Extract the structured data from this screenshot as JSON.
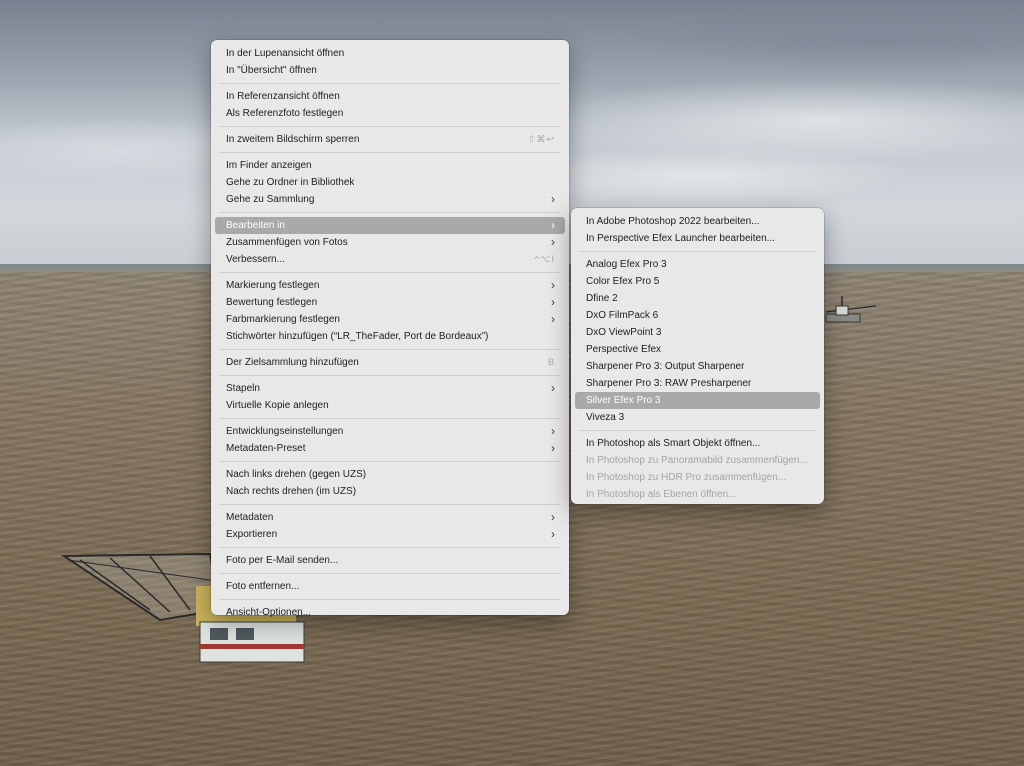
{
  "main_menu": {
    "groups": [
      [
        {
          "label": "In der Lupenansicht öffnen"
        },
        {
          "label": "In \"Übersicht\" öffnen"
        }
      ],
      [
        {
          "label": "In Referenzansicht öffnen"
        },
        {
          "label": "Als Referenzfoto festlegen"
        }
      ],
      [
        {
          "label": "In zweitem Bildschirm sperren",
          "shortcut": "⇧⌘↩"
        }
      ],
      [
        {
          "label": "Im Finder anzeigen"
        },
        {
          "label": "Gehe zu Ordner in Bibliothek"
        },
        {
          "label": "Gehe zu Sammlung",
          "submenu": true
        }
      ],
      [
        {
          "label": "Bearbeiten in",
          "submenu": true,
          "highlighted": true
        },
        {
          "label": "Zusammenfügen von Fotos",
          "submenu": true
        },
        {
          "label": "Verbessern...",
          "shortcut": "^⌥I"
        }
      ],
      [
        {
          "label": "Markierung festlegen",
          "submenu": true
        },
        {
          "label": "Bewertung festlegen",
          "submenu": true
        },
        {
          "label": "Farbmarkierung festlegen",
          "submenu": true
        },
        {
          "label": "Stichwörter hinzufügen (“LR_TheFader, Port de Bordeaux”)"
        }
      ],
      [
        {
          "label": "Der Zielsammlung hinzufügen",
          "shortcut": "B"
        }
      ],
      [
        {
          "label": "Stapeln",
          "submenu": true
        },
        {
          "label": "Virtuelle Kopie anlegen"
        }
      ],
      [
        {
          "label": "Entwicklungseinstellungen",
          "submenu": true
        },
        {
          "label": "Metadaten-Preset",
          "submenu": true
        }
      ],
      [
        {
          "label": "Nach links drehen (gegen UZS)"
        },
        {
          "label": "Nach rechts drehen (im UZS)"
        }
      ],
      [
        {
          "label": "Metadaten",
          "submenu": true
        },
        {
          "label": "Exportieren",
          "submenu": true
        }
      ],
      [
        {
          "label": "Foto per E-Mail senden..."
        }
      ],
      [
        {
          "label": "Foto entfernen..."
        }
      ],
      [
        {
          "label": "Ansicht-Optionen..."
        }
      ]
    ]
  },
  "sub_menu": {
    "groups": [
      [
        {
          "label": "In Adobe Photoshop 2022 bearbeiten..."
        },
        {
          "label": "In Perspective Efex Launcher bearbeiten..."
        }
      ],
      [
        {
          "label": "Analog Efex Pro 3"
        },
        {
          "label": "Color Efex Pro 5"
        },
        {
          "label": "Dfine 2"
        },
        {
          "label": "DxO FilmPack 6"
        },
        {
          "label": "DxO ViewPoint 3"
        },
        {
          "label": "Perspective Efex"
        },
        {
          "label": "Sharpener Pro 3: Output Sharpener"
        },
        {
          "label": "Sharpener Pro 3: RAW Presharpener"
        },
        {
          "label": "Silver Efex Pro 3",
          "highlighted": true
        },
        {
          "label": "Viveza 3"
        }
      ],
      [
        {
          "label": "In Photoshop als Smart Objekt öffnen..."
        },
        {
          "label": "In Photoshop zu Panoramabild zusammenfügen...",
          "disabled": true
        },
        {
          "label": "In Photoshop zu HDR Pro zusammenfügen...",
          "disabled": true
        },
        {
          "label": "In Photoshop als Ebenen öffnen...",
          "disabled": true
        }
      ]
    ]
  },
  "icons": {
    "submenu_arrow": "chevron-right-icon"
  },
  "colors": {
    "menu_bg": "#e8e8e8",
    "highlight_bg": "#a9a9a9",
    "disabled_text": "#a4a4a4"
  }
}
